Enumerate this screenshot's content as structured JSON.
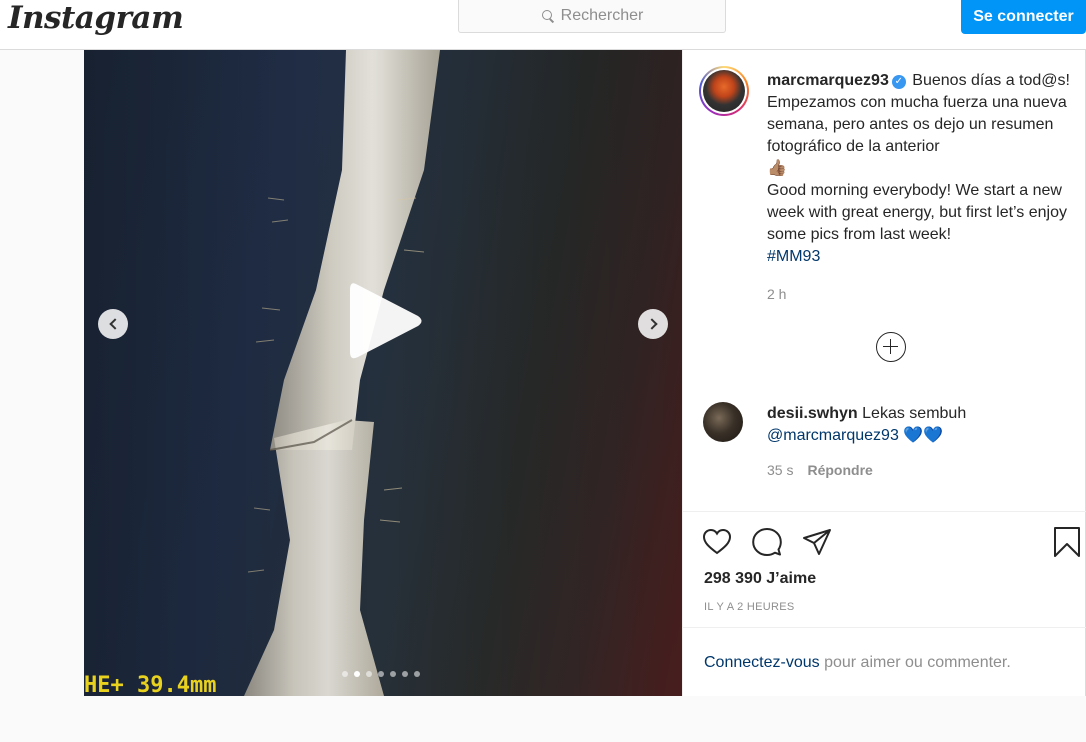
{
  "header": {
    "logo": "Instagram",
    "search_placeholder": "Rechercher",
    "login_button": "Se connecter"
  },
  "post": {
    "author": "marcmarquez93",
    "verified_mark": "✓",
    "caption_es": "Buenos días a tod@s! Empezamos con mucha fuerza una nueva semana, pero antes os dejo un resumen fotográfico de la anterior",
    "caption_emoji": "👍🏽",
    "caption_en": "Good morning everybody! We start a new week with great energy, but first let’s enjoy some pics from last week!",
    "hashtag": "#MM93",
    "time": "2 h",
    "media": {
      "overlay_text": "HE+ 39.4mm",
      "carousel_count": 7,
      "carousel_active": 1
    },
    "comment": {
      "user": "desii.swhyn",
      "text": "Lekas sembuh",
      "mention": "@marcmarquez93",
      "emojis": "💙💙",
      "time": "35 s",
      "reply_label": "Répondre"
    },
    "likes": "298 390 J’aime",
    "posted_ago": "IL Y A 2 HEURES",
    "login_link": "Connectez-vous",
    "login_suffix": " pour aimer ou commenter."
  },
  "icons": {
    "search": "search-icon",
    "play": "play-icon",
    "prev": "chevron-left-icon",
    "next": "chevron-right-icon",
    "more": "plus-circle-icon",
    "like": "heart-icon",
    "comment": "comment-icon",
    "share": "paper-plane-icon",
    "save": "bookmark-icon"
  },
  "colors": {
    "accent": "#0095f6",
    "link": "#00376b",
    "muted": "#8e8e8e"
  }
}
